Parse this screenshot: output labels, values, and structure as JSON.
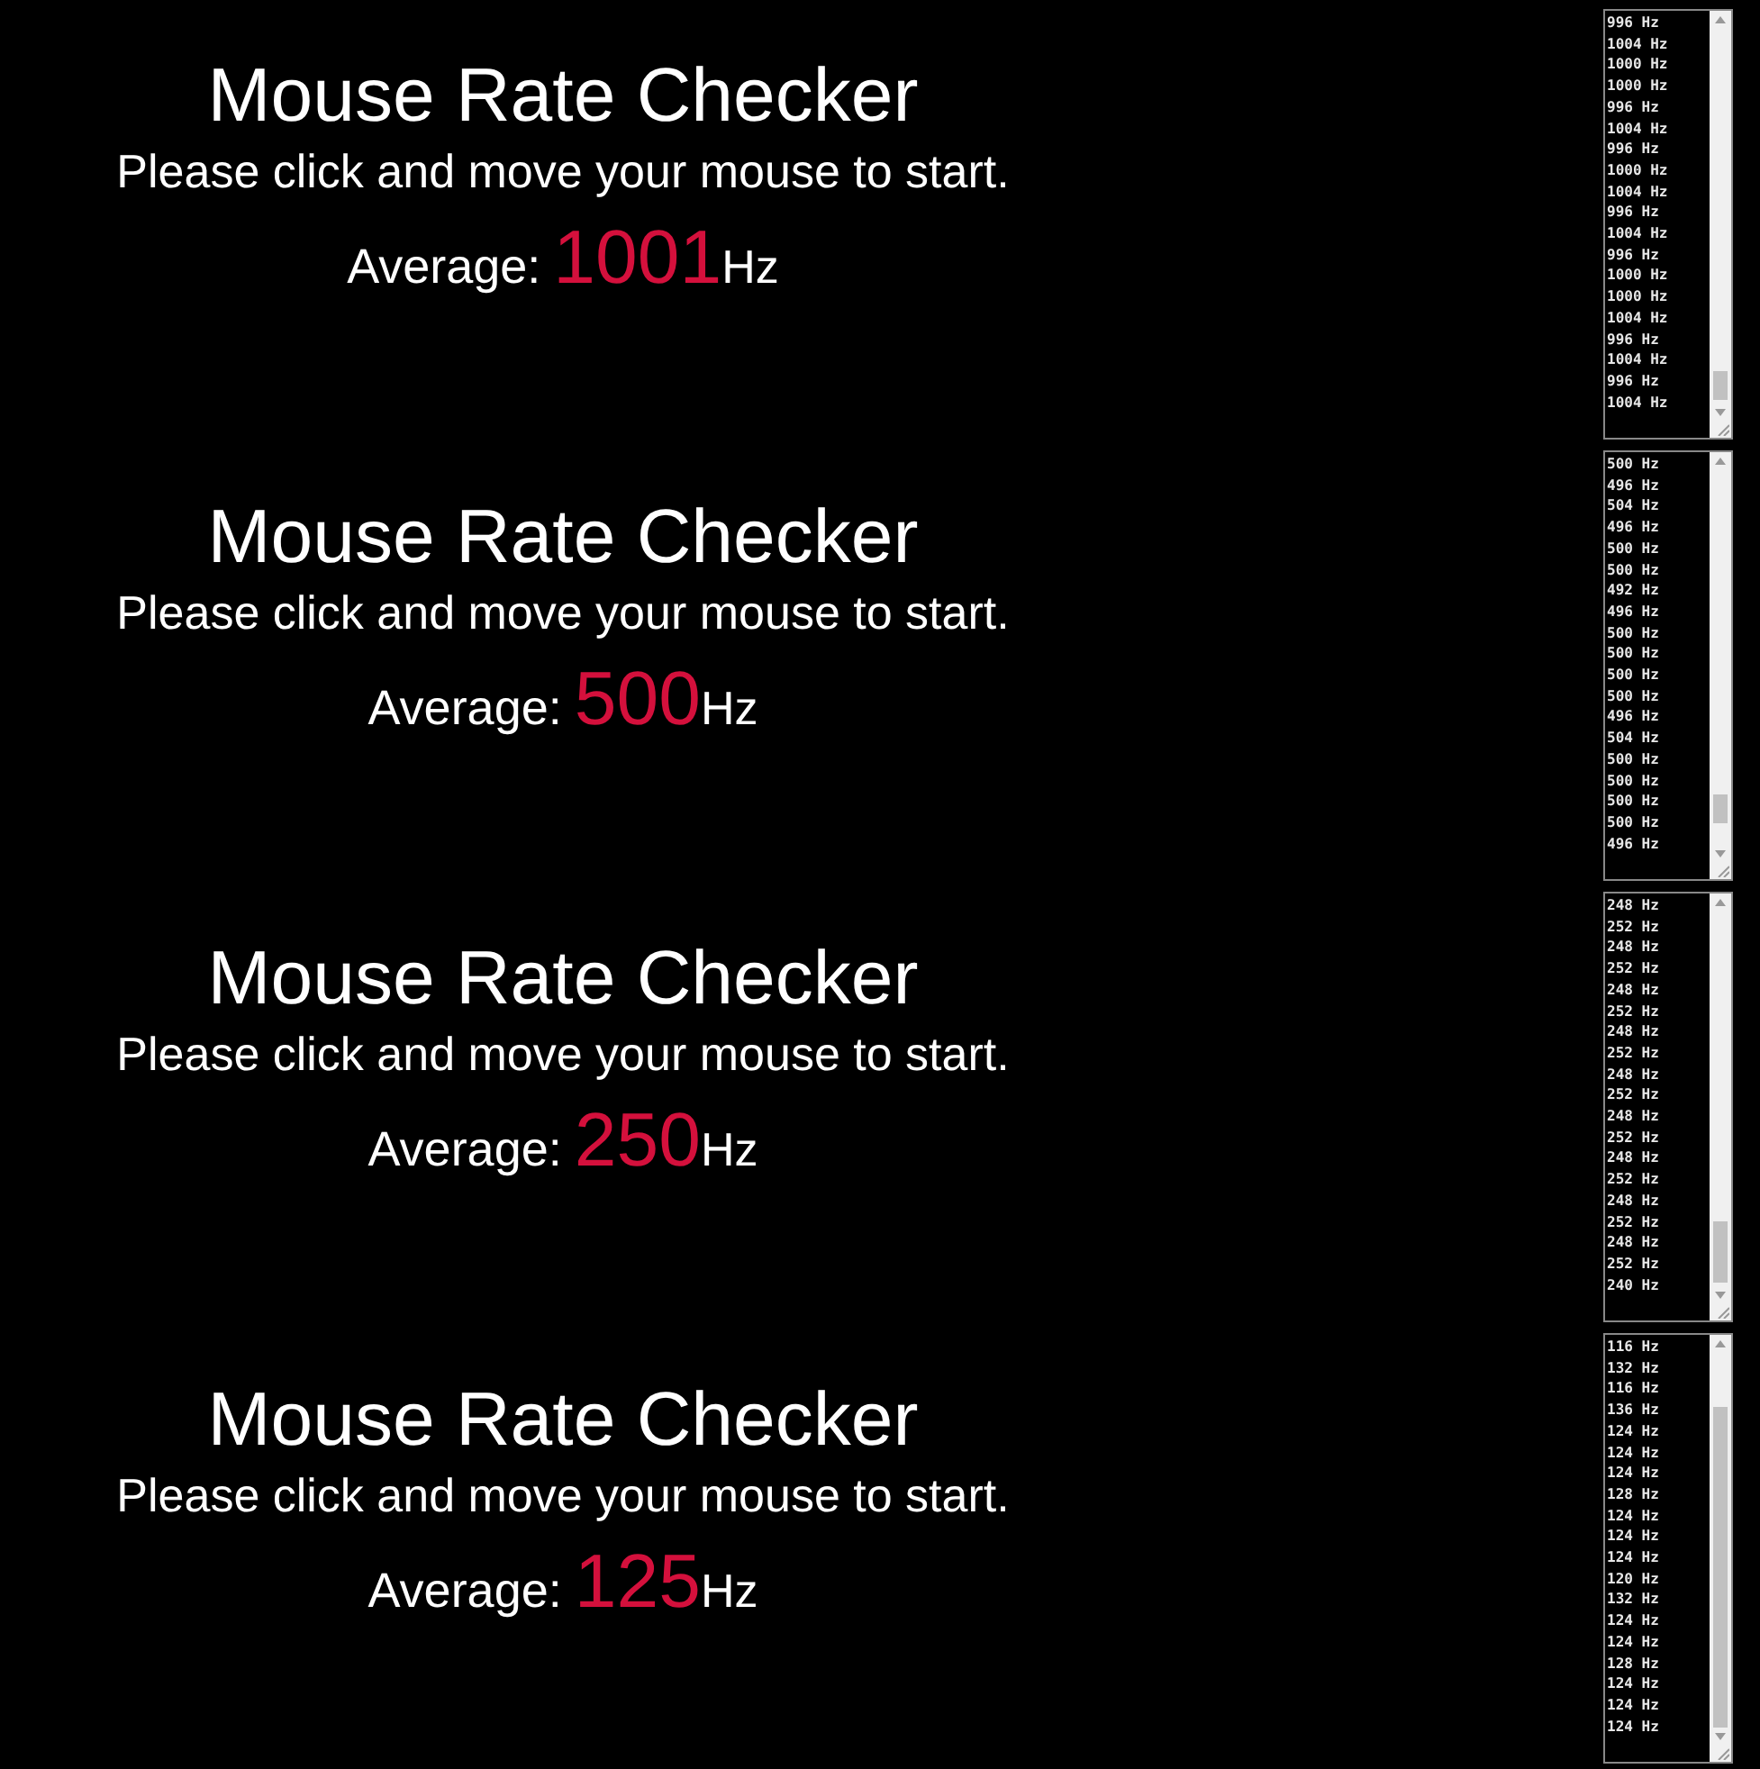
{
  "panels": [
    {
      "title": "Mouse Rate Checker",
      "instruction": "Please click and move your mouse to start.",
      "average_label": "Average:",
      "average_value": "1001",
      "unit": "Hz",
      "log": [
        "996 Hz",
        "1004 Hz",
        "1000 Hz",
        "1000 Hz",
        "996 Hz",
        "1004 Hz",
        "996 Hz",
        "1000 Hz",
        "1004 Hz",
        "996 Hz",
        "1004 Hz",
        "996 Hz",
        "1000 Hz",
        "1000 Hz",
        "1004 Hz",
        "996 Hz",
        "1004 Hz",
        "996 Hz",
        "1004 Hz"
      ]
    },
    {
      "title": "Mouse Rate Checker",
      "instruction": "Please click and move your mouse to start.",
      "average_label": "Average:",
      "average_value": "500",
      "unit": "Hz",
      "log": [
        "500 Hz",
        "496 Hz",
        "504 Hz",
        "496 Hz",
        "500 Hz",
        "500 Hz",
        "492 Hz",
        "496 Hz",
        "500 Hz",
        "500 Hz",
        "500 Hz",
        "500 Hz",
        "496 Hz",
        "504 Hz",
        "500 Hz",
        "500 Hz",
        "500 Hz",
        "500 Hz",
        "496 Hz"
      ]
    },
    {
      "title": "Mouse Rate Checker",
      "instruction": "Please click and move your mouse to start.",
      "average_label": "Average:",
      "average_value": "250",
      "unit": "Hz",
      "log": [
        "248 Hz",
        "252 Hz",
        "248 Hz",
        "252 Hz",
        "248 Hz",
        "252 Hz",
        "248 Hz",
        "252 Hz",
        "248 Hz",
        "252 Hz",
        "248 Hz",
        "252 Hz",
        "248 Hz",
        "252 Hz",
        "248 Hz",
        "252 Hz",
        "248 Hz",
        "252 Hz",
        "240 Hz"
      ]
    },
    {
      "title": "Mouse Rate Checker",
      "instruction": "Please click and move your mouse to start.",
      "average_label": "Average:",
      "average_value": "125",
      "unit": "Hz",
      "log": [
        "116 Hz",
        "132 Hz",
        "116 Hz",
        "136 Hz",
        "124 Hz",
        "124 Hz",
        "124 Hz",
        "128 Hz",
        "124 Hz",
        "124 Hz",
        "124 Hz",
        "120 Hz",
        "132 Hz",
        "124 Hz",
        "124 Hz",
        "128 Hz",
        "124 Hz",
        "124 Hz",
        "124 Hz"
      ]
    }
  ]
}
